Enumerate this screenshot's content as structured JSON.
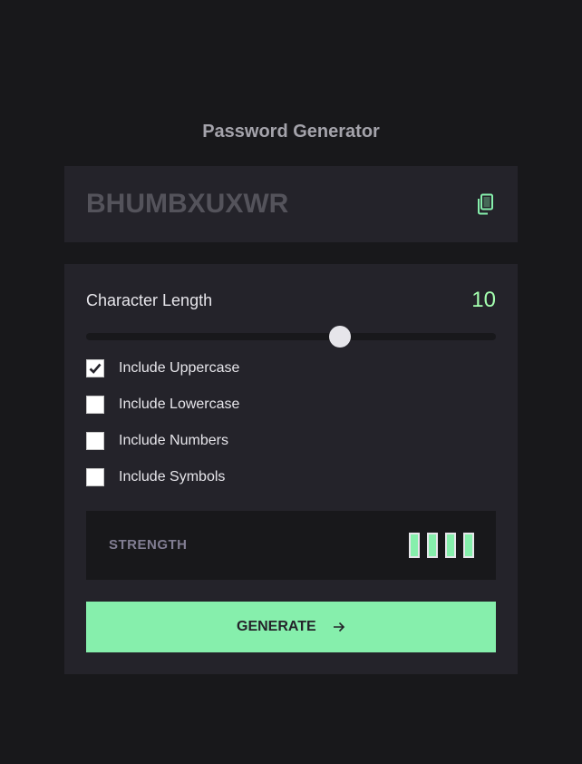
{
  "app": {
    "title": "Password Generator"
  },
  "output": {
    "password": "BHUMBXUXWR",
    "copy_icon": "copy-icon"
  },
  "length": {
    "label": "Character Length",
    "value": "10",
    "slider_fraction": 0.62
  },
  "options": [
    {
      "label": "Include Uppercase",
      "checked": true
    },
    {
      "label": "Include Lowercase",
      "checked": false
    },
    {
      "label": "Include Numbers",
      "checked": false
    },
    {
      "label": "Include Symbols",
      "checked": false
    }
  ],
  "strength": {
    "label": "STRENGTH",
    "bars_filled": 4,
    "bars_total": 4
  },
  "generate": {
    "label": "GENERATE",
    "icon": "arrow-right-icon"
  },
  "colors": {
    "background": "#18181b",
    "panel": "#24232a",
    "accent": "#a4ffaf",
    "button": "#86efac",
    "password_text": "#54535b",
    "strength_bar": "#86efac"
  }
}
